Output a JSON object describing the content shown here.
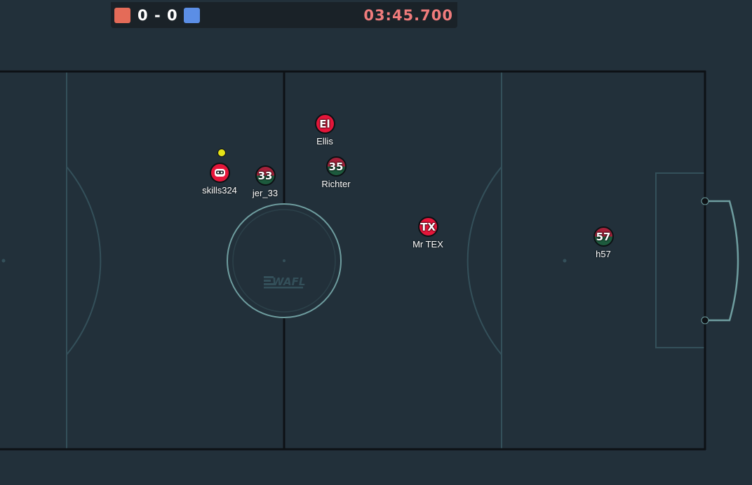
{
  "scoreboard": {
    "red_score": "0",
    "separator": "-",
    "blue_score": "0",
    "clock": "03:45.700",
    "red_color": "#e46b58",
    "blue_color": "#5b8ee6",
    "clock_color": "#f07c7c"
  },
  "field": {
    "logo_text": "WAFL"
  },
  "players": [
    {
      "name": "skills324",
      "avatar": "",
      "avatar_icon": "robot-face-icon",
      "team": "red"
    },
    {
      "name": "jer_33",
      "avatar": "33",
      "team": "green"
    },
    {
      "name": "Ellis",
      "avatar": "El",
      "team": "red"
    },
    {
      "name": "Richter",
      "avatar": "35",
      "team": "green"
    },
    {
      "name": "Mr TEX",
      "avatar": "TX",
      "team": "red"
    },
    {
      "name": "h57",
      "avatar": "57",
      "team": "green"
    }
  ],
  "colors": {
    "background": "#22303a",
    "boundary": "#0d1115",
    "field_lines": "#34505a",
    "goal_lines": "#6f9ea0"
  }
}
